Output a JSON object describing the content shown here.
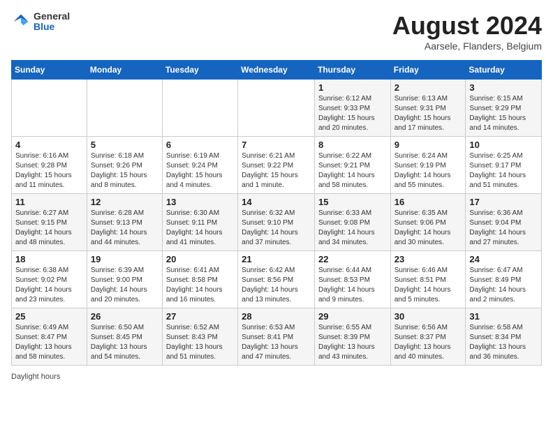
{
  "header": {
    "logo_general": "General",
    "logo_blue": "Blue",
    "title": "August 2024",
    "location": "Aarsele, Flanders, Belgium"
  },
  "weekdays": [
    "Sunday",
    "Monday",
    "Tuesday",
    "Wednesday",
    "Thursday",
    "Friday",
    "Saturday"
  ],
  "weeks": [
    [
      {
        "day": "",
        "detail": ""
      },
      {
        "day": "",
        "detail": ""
      },
      {
        "day": "",
        "detail": ""
      },
      {
        "day": "",
        "detail": ""
      },
      {
        "day": "1",
        "detail": "Sunrise: 6:12 AM\nSunset: 9:33 PM\nDaylight: 15 hours and 20 minutes."
      },
      {
        "day": "2",
        "detail": "Sunrise: 6:13 AM\nSunset: 9:31 PM\nDaylight: 15 hours and 17 minutes."
      },
      {
        "day": "3",
        "detail": "Sunrise: 6:15 AM\nSunset: 9:29 PM\nDaylight: 15 hours and 14 minutes."
      }
    ],
    [
      {
        "day": "4",
        "detail": "Sunrise: 6:16 AM\nSunset: 9:28 PM\nDaylight: 15 hours and 11 minutes."
      },
      {
        "day": "5",
        "detail": "Sunrise: 6:18 AM\nSunset: 9:26 PM\nDaylight: 15 hours and 8 minutes."
      },
      {
        "day": "6",
        "detail": "Sunrise: 6:19 AM\nSunset: 9:24 PM\nDaylight: 15 hours and 4 minutes."
      },
      {
        "day": "7",
        "detail": "Sunrise: 6:21 AM\nSunset: 9:22 PM\nDaylight: 15 hours and 1 minute."
      },
      {
        "day": "8",
        "detail": "Sunrise: 6:22 AM\nSunset: 9:21 PM\nDaylight: 14 hours and 58 minutes."
      },
      {
        "day": "9",
        "detail": "Sunrise: 6:24 AM\nSunset: 9:19 PM\nDaylight: 14 hours and 55 minutes."
      },
      {
        "day": "10",
        "detail": "Sunrise: 6:25 AM\nSunset: 9:17 PM\nDaylight: 14 hours and 51 minutes."
      }
    ],
    [
      {
        "day": "11",
        "detail": "Sunrise: 6:27 AM\nSunset: 9:15 PM\nDaylight: 14 hours and 48 minutes."
      },
      {
        "day": "12",
        "detail": "Sunrise: 6:28 AM\nSunset: 9:13 PM\nDaylight: 14 hours and 44 minutes."
      },
      {
        "day": "13",
        "detail": "Sunrise: 6:30 AM\nSunset: 9:11 PM\nDaylight: 14 hours and 41 minutes."
      },
      {
        "day": "14",
        "detail": "Sunrise: 6:32 AM\nSunset: 9:10 PM\nDaylight: 14 hours and 37 minutes."
      },
      {
        "day": "15",
        "detail": "Sunrise: 6:33 AM\nSunset: 9:08 PM\nDaylight: 14 hours and 34 minutes."
      },
      {
        "day": "16",
        "detail": "Sunrise: 6:35 AM\nSunset: 9:06 PM\nDaylight: 14 hours and 30 minutes."
      },
      {
        "day": "17",
        "detail": "Sunrise: 6:36 AM\nSunset: 9:04 PM\nDaylight: 14 hours and 27 minutes."
      }
    ],
    [
      {
        "day": "18",
        "detail": "Sunrise: 6:38 AM\nSunset: 9:02 PM\nDaylight: 14 hours and 23 minutes."
      },
      {
        "day": "19",
        "detail": "Sunrise: 6:39 AM\nSunset: 9:00 PM\nDaylight: 14 hours and 20 minutes."
      },
      {
        "day": "20",
        "detail": "Sunrise: 6:41 AM\nSunset: 8:58 PM\nDaylight: 14 hours and 16 minutes."
      },
      {
        "day": "21",
        "detail": "Sunrise: 6:42 AM\nSunset: 8:56 PM\nDaylight: 14 hours and 13 minutes."
      },
      {
        "day": "22",
        "detail": "Sunrise: 6:44 AM\nSunset: 8:53 PM\nDaylight: 14 hours and 9 minutes."
      },
      {
        "day": "23",
        "detail": "Sunrise: 6:46 AM\nSunset: 8:51 PM\nDaylight: 14 hours and 5 minutes."
      },
      {
        "day": "24",
        "detail": "Sunrise: 6:47 AM\nSunset: 8:49 PM\nDaylight: 14 hours and 2 minutes."
      }
    ],
    [
      {
        "day": "25",
        "detail": "Sunrise: 6:49 AM\nSunset: 8:47 PM\nDaylight: 13 hours and 58 minutes."
      },
      {
        "day": "26",
        "detail": "Sunrise: 6:50 AM\nSunset: 8:45 PM\nDaylight: 13 hours and 54 minutes."
      },
      {
        "day": "27",
        "detail": "Sunrise: 6:52 AM\nSunset: 8:43 PM\nDaylight: 13 hours and 51 minutes."
      },
      {
        "day": "28",
        "detail": "Sunrise: 6:53 AM\nSunset: 8:41 PM\nDaylight: 13 hours and 47 minutes."
      },
      {
        "day": "29",
        "detail": "Sunrise: 6:55 AM\nSunset: 8:39 PM\nDaylight: 13 hours and 43 minutes."
      },
      {
        "day": "30",
        "detail": "Sunrise: 6:56 AM\nSunset: 8:37 PM\nDaylight: 13 hours and 40 minutes."
      },
      {
        "day": "31",
        "detail": "Sunrise: 6:58 AM\nSunset: 8:34 PM\nDaylight: 13 hours and 36 minutes."
      }
    ]
  ],
  "footer": {
    "daylight_label": "Daylight hours"
  }
}
